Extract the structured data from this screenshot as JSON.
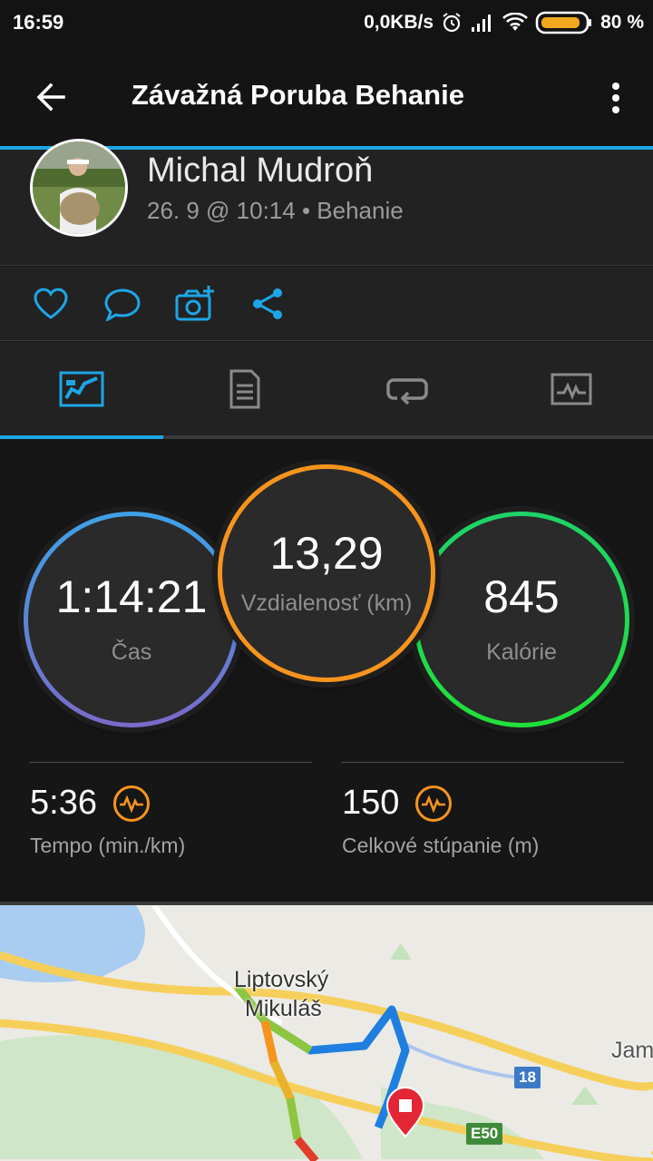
{
  "status_bar": {
    "time": "16:59",
    "network_speed": "0,0KB/s",
    "battery": "80 %"
  },
  "app_bar": {
    "title": "Závažná Poruba Behanie",
    "back_icon": "arrow-left-icon",
    "menu_icon": "more-vertical-icon"
  },
  "user": {
    "name": "Michal Mudroň",
    "meta": "26. 9 @ 10:14 • Behanie"
  },
  "actions": [
    {
      "name": "like",
      "icon": "heart-icon"
    },
    {
      "name": "comment",
      "icon": "comment-icon"
    },
    {
      "name": "add-photo",
      "icon": "camera-add-icon"
    },
    {
      "name": "share",
      "icon": "share-icon"
    }
  ],
  "tabs": [
    {
      "name": "overview",
      "icon": "course-icon",
      "active": true
    },
    {
      "name": "details",
      "icon": "document-icon",
      "active": false
    },
    {
      "name": "laps",
      "icon": "loop-icon",
      "active": false
    },
    {
      "name": "charts",
      "icon": "graph-icon",
      "active": false
    }
  ],
  "stats": {
    "time": {
      "value": "1:14:21",
      "label": "Čas"
    },
    "distance": {
      "value": "13,29",
      "label": "Vzdialenosť (km)"
    },
    "calories": {
      "value": "845",
      "label": "Kalórie"
    },
    "pace": {
      "value": "5:36",
      "label": "Tempo (min./km)"
    },
    "elevation": {
      "value": "150",
      "label": "Celkové stúpanie (m)"
    }
  },
  "map": {
    "labels": {
      "city_line1": "Liptovský",
      "city_line2": "Mikuláš",
      "edge": "Jam"
    },
    "roads": {
      "r18": "18",
      "e50": "E50"
    }
  },
  "colors": {
    "accent": "#1da6e6",
    "distance_ring": "#f7941d",
    "calories_ring": "#22e03a",
    "time_ring": "#3da2e8"
  }
}
